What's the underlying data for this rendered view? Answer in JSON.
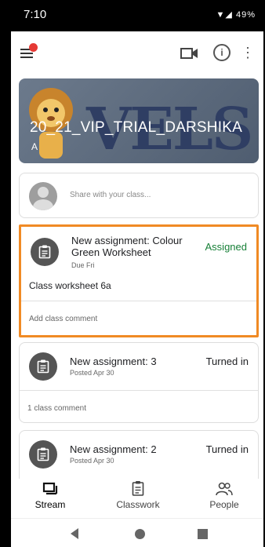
{
  "status_bar": {
    "time": "7:10",
    "battery": "49%"
  },
  "header": {
    "class_title": "20_21_VIP_TRIAL_DARSHIKA",
    "section": "A",
    "banner_watermark": "VELS"
  },
  "share": {
    "placeholder": "Share with your class..."
  },
  "stream": [
    {
      "title": "New assignment: Colour Green Worksheet",
      "meta": "Due Fri",
      "status": "Assigned",
      "status_color": "#188038",
      "description": "Class worksheet 6a",
      "comment_text": "Add class comment"
    },
    {
      "title": "New assignment: 3",
      "meta": "Posted Apr 30",
      "status": "Turned in",
      "status_color": "#202124",
      "comment_text": "1 class comment"
    },
    {
      "title": "New assignment: 2",
      "meta": "Posted Apr 30",
      "status": "Turned in",
      "status_color": "#202124"
    }
  ],
  "bottom_nav": [
    {
      "label": "Stream",
      "icon": "stream-icon"
    },
    {
      "label": "Classwork",
      "icon": "classwork-icon"
    },
    {
      "label": "People",
      "icon": "people-icon"
    }
  ],
  "colors": {
    "highlight": "#f08a24",
    "assigned": "#188038"
  }
}
